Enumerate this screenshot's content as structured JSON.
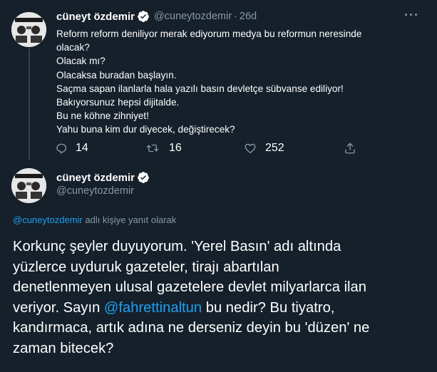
{
  "colors": {
    "background": "#15202b",
    "text": "#ffffff",
    "secondary": "#8899a6",
    "link": "#1da1f2",
    "verified": "#ffffff"
  },
  "tweet1": {
    "display_name": "cüneyt özdemir",
    "handle": "@cuneytozdemir",
    "separator": "·",
    "time": "26d",
    "lines": [
      "Reform reform deniliyor merak ediyorum medya bu reformun neresinde",
      "olacak?",
      "Olacak mı?",
      "Olacaksa buradan başlayın.",
      "Saçma sapan ilanlarla hala yazılı basın devletçe sübvanse ediliyor!",
      "Bakıyorsunuz hepsi dijitalde.",
      "Bu ne köhne zihniyet!",
      "Yahu buna kim dur diyecek, değiştirecek?"
    ],
    "actions": {
      "reply_count": "14",
      "retweet_count": "16",
      "like_count": "252"
    },
    "icons": [
      "reply-icon",
      "retweet-icon",
      "like-icon",
      "share-icon",
      "more-icon",
      "verified-icon"
    ]
  },
  "tweet2": {
    "display_name": "cüneyt özdemir",
    "handle": "@cuneytozdemir",
    "reply_to_mention": "@cuneytozdemir",
    "reply_to_suffix": " adlı kişiye yanıt olarak",
    "lines": [
      {
        "text": "Korkunç şeyler duyuyorum. 'Yerel Basın' adı altında"
      },
      {
        "text": "yüzlerce uyduruk gazeteler, tirajı abartılan"
      },
      {
        "text": "denetlenmeyen ulusal gazetelere devlet milyarlarca ilan"
      },
      {
        "pre": "veriyor. Sayın ",
        "mention": "@fahrettinaltun",
        "post": " bu nedir?  Bu tiyatro,"
      },
      {
        "text": "kandırmaca, artık adına ne derseniz deyin bu 'düzen' ne"
      },
      {
        "text": "zaman bitecek?"
      }
    ]
  }
}
